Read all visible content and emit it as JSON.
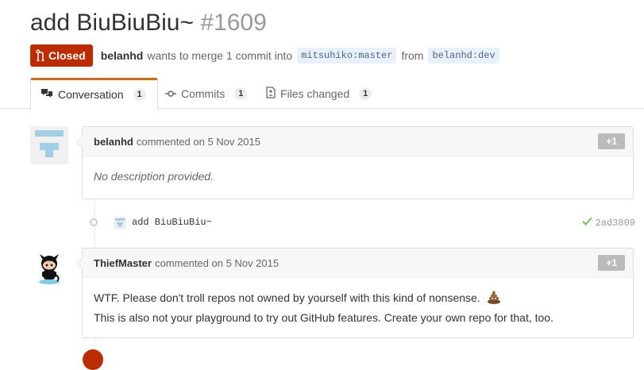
{
  "pr": {
    "title": "add BiuBiuBiu~",
    "number": "#1609",
    "state": "Closed",
    "author": "belanhd",
    "merge_text": "wants to merge 1 commit into",
    "base_branch": "mitsuhiko:master",
    "from_text": "from",
    "head_branch": "belanhd:dev"
  },
  "tabs": [
    {
      "label": "Conversation",
      "count": "1",
      "icon": "comment-discussion-icon"
    },
    {
      "label": "Commits",
      "count": "1",
      "icon": "git-commit-icon"
    },
    {
      "label": "Files changed",
      "count": "1",
      "icon": "diff-icon"
    }
  ],
  "comments": [
    {
      "author": "belanhd",
      "action": "commented on 5 Nov 2015",
      "reaction": "+1",
      "body_lines": [
        "No description provided."
      ]
    },
    {
      "author": "ThiefMaster",
      "action": "commented on 5 Nov 2015",
      "reaction": "+1",
      "body_lines": [
        "WTF. Please don't troll repos not owned by yourself with this kind of nonsense.",
        "This is also not your playground to try out GitHub features. Create your own repo for that, too."
      ],
      "emoji": "pile-of-poo-icon"
    }
  ],
  "commit": {
    "message": "add BiuBiuBiu~",
    "sha": "2ad3809",
    "status": "check-icon"
  },
  "colors": {
    "closed": "#bd2c00",
    "selected_tab_accent": "#d26911",
    "identicon": "#a3cfe6",
    "success": "#6cc644"
  }
}
